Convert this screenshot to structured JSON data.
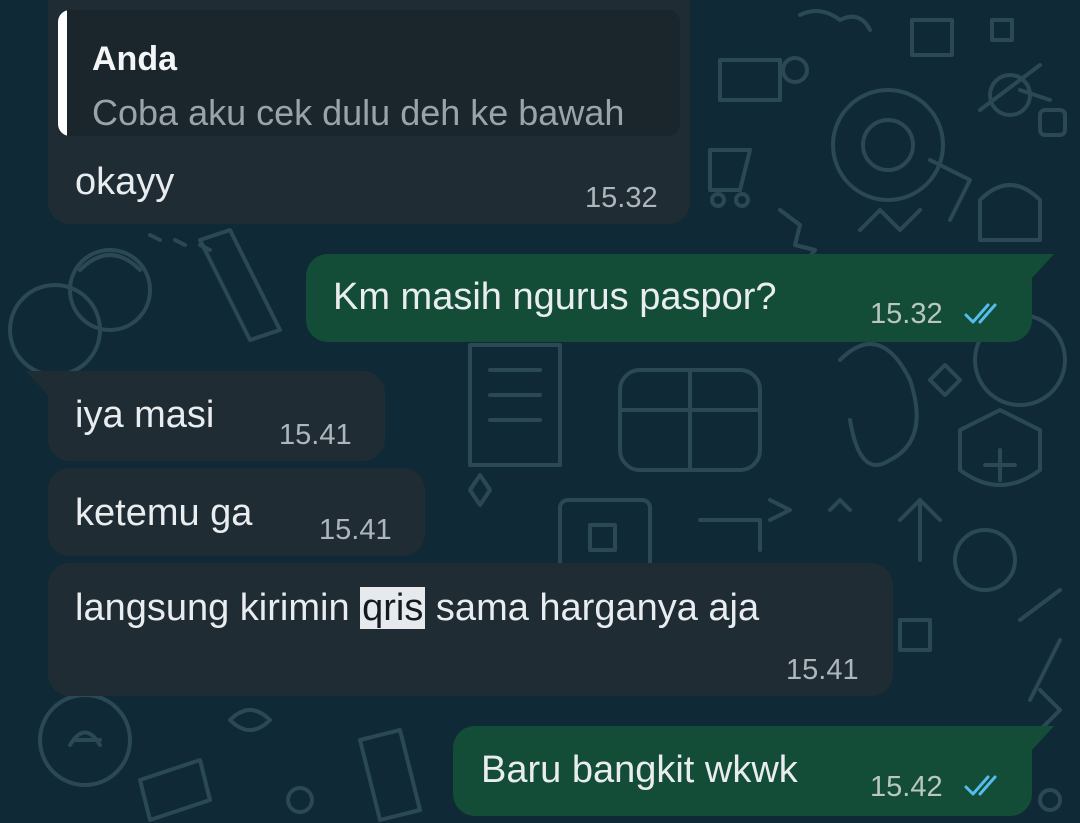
{
  "colors": {
    "incoming_bubble": "#1f2c34",
    "outgoing_bubble": "#144d37",
    "background": "#0f2a36",
    "read_ticks": "#53bdeb"
  },
  "messages": [
    {
      "direction": "incoming",
      "reply_to": {
        "author": "Anda",
        "text": "Coba aku cek dulu deh ke bawah"
      },
      "text": "okayy",
      "time": "15.32"
    },
    {
      "direction": "outgoing",
      "text": "Km masih ngurus paspor?",
      "time": "15.32",
      "status_icon": "double-check-read-icon"
    },
    {
      "direction": "incoming",
      "text": "iya masi",
      "time": "15.41"
    },
    {
      "direction": "incoming",
      "text": "ketemu ga",
      "time": "15.41"
    },
    {
      "direction": "incoming",
      "text_before": "langsung kirimin ",
      "text_highlight": "qris",
      "text_after": " sama harganya aja",
      "time": "15.41"
    },
    {
      "direction": "outgoing",
      "text": "Baru bangkit wkwk",
      "time": "15.42",
      "status_icon": "double-check-read-icon"
    }
  ]
}
